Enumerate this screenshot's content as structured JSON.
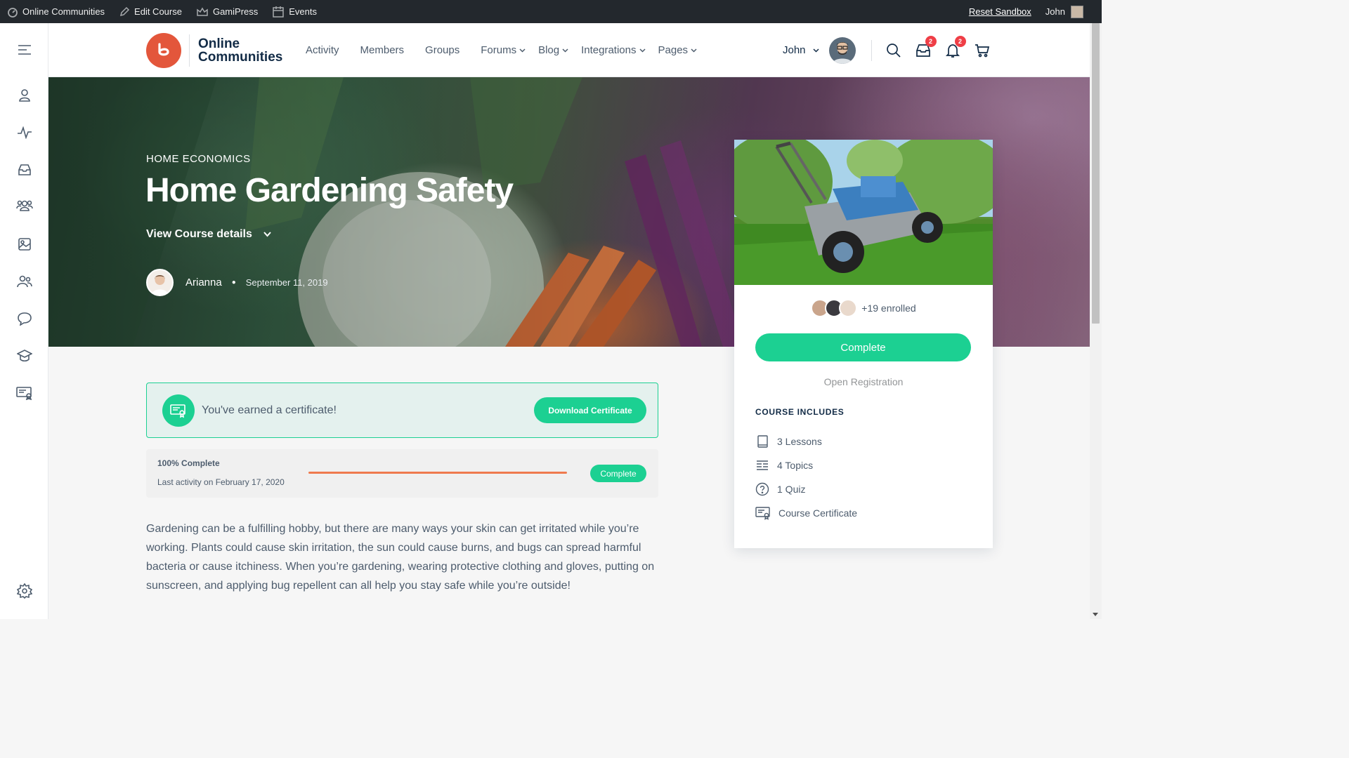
{
  "adminbar": {
    "items": [
      {
        "label": "Online Communities",
        "icon": "dashboard-icon"
      },
      {
        "label": "Edit Course",
        "icon": "pencil-icon"
      },
      {
        "label": "GamiPress",
        "icon": "crown-icon"
      },
      {
        "label": "Events",
        "icon": "calendar-icon"
      }
    ],
    "reset_label": "Reset Sandbox",
    "user": "John"
  },
  "header": {
    "logo_line1": "Online",
    "logo_line2": "Communities",
    "nav": [
      {
        "label": "Activity",
        "dropdown": false
      },
      {
        "label": "Members",
        "dropdown": false
      },
      {
        "label": "Groups",
        "dropdown": false
      },
      {
        "label": "Forums",
        "dropdown": true
      },
      {
        "label": "Blog",
        "dropdown": true
      },
      {
        "label": "Integrations",
        "dropdown": true
      },
      {
        "label": "Pages",
        "dropdown": true
      }
    ],
    "user_name": "John",
    "messages_count": "2",
    "notifications_count": "2"
  },
  "hero": {
    "category": "HOME ECONOMICS",
    "title": "Home Gardening Safety",
    "details_label": "View Course details",
    "author": "Arianna",
    "date": "September 11, 2019"
  },
  "card": {
    "enrolled": "+19 enrolled",
    "complete_label": "Complete",
    "open_registration": "Open Registration",
    "includes_title": "COURSE INCLUDES",
    "includes": [
      {
        "label": "3 Lessons",
        "icon": "book-icon"
      },
      {
        "label": "4 Topics",
        "icon": "list-icon"
      },
      {
        "label": "1 Quiz",
        "icon": "question-icon"
      },
      {
        "label": "Course Certificate",
        "icon": "certificate-icon"
      }
    ]
  },
  "certificate": {
    "text": "You've earned a certificate!",
    "button": "Download Certificate"
  },
  "progress": {
    "label": "100% Complete",
    "activity": "Last activity on February 17, 2020",
    "percent": 100,
    "badge": "Complete"
  },
  "description": "Gardening can be a fulfilling hobby, but there are many ways your skin can get irritated while you’re working. Plants could cause skin irritation, the sun could cause burns, and bugs can spread harmful bacteria or cause itchiness. When you’re gardening, wearing protective clothing and gloves, putting on sunscreen, and applying bug repellent can all help you stay safe while you’re outside!",
  "colors": {
    "accent": "#1cd092",
    "brand": "#e3563b",
    "progress": "#ef7a4e",
    "badge": "#ef3e46"
  }
}
